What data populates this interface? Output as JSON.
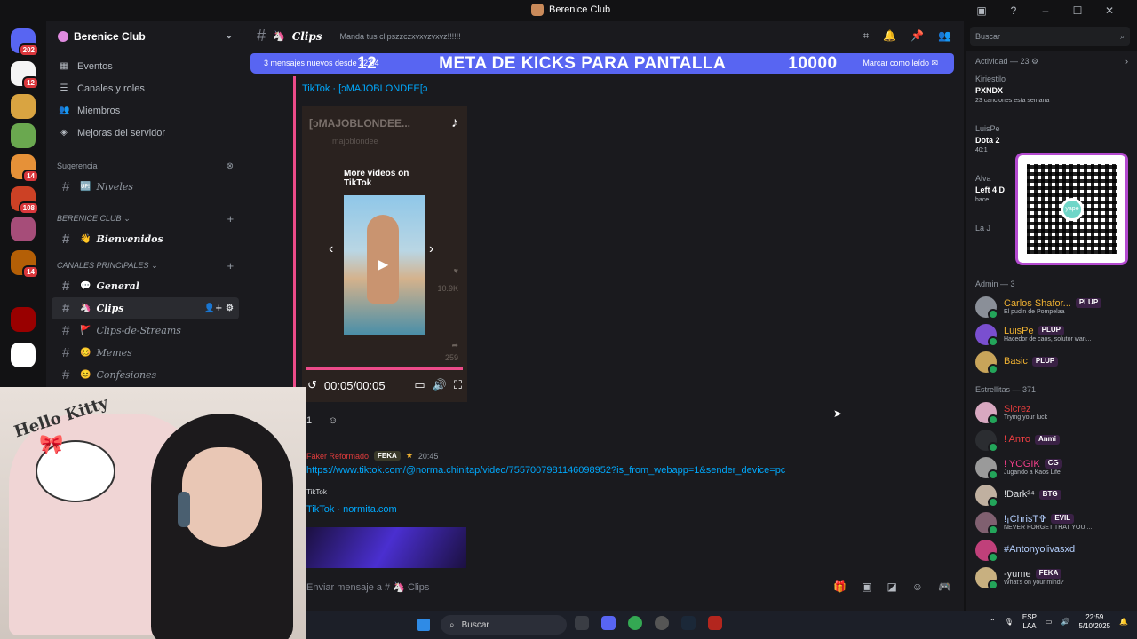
{
  "window": {
    "title": "Berenice Club"
  },
  "servers": [
    {
      "color": "#5865f2",
      "badge": "202",
      "icon": "discord-icon"
    },
    {
      "color": "#f5f5f5",
      "badge": "12",
      "icon": "server-icon"
    },
    {
      "color": "#d9a441",
      "badge": "",
      "icon": "server-icon"
    },
    {
      "color": "#6aa84f",
      "badge": "",
      "icon": "server-icon"
    },
    {
      "color": "#e69138",
      "badge": "14",
      "icon": "server-icon"
    },
    {
      "color": "#cc4125",
      "badge": "108",
      "icon": "server-icon"
    },
    {
      "color": "#a64d79",
      "badge": "",
      "icon": "server-icon"
    },
    {
      "color": "#b45f06",
      "badge": "14",
      "icon": "server-icon"
    },
    {
      "color": "#990000",
      "badge": "",
      "icon": "server-icon"
    },
    {
      "color": "#ffffff",
      "badge": "",
      "icon": "server-icon"
    }
  ],
  "guild": {
    "name": "Berenice Club",
    "nav": [
      {
        "label": "Eventos",
        "icon": "calendar-icon"
      },
      {
        "label": "Canales y roles",
        "icon": "list-icon"
      },
      {
        "label": "Miembros",
        "icon": "members-icon"
      },
      {
        "label": "Mejoras del servidor",
        "icon": "boost-icon"
      }
    ],
    "suggestion_label": "Sugerencia",
    "suggestion_channel": "Niveles",
    "cat1": "BERENICE CLUB",
    "welcome_channel": "Bienvenidos",
    "cat2": "CANALES PRINCIPALES",
    "channels": [
      {
        "name": "General",
        "emoji": "💬",
        "state": "bold"
      },
      {
        "name": "Clips",
        "emoji": "🦄",
        "state": "active"
      },
      {
        "name": "Clips-de-Streams",
        "emoji": "🚩",
        "state": ""
      },
      {
        "name": "Memes",
        "emoji": "🥴",
        "state": ""
      },
      {
        "name": "Confesiones",
        "emoji": "😊",
        "state": ""
      }
    ]
  },
  "channel": {
    "name": "Clips",
    "topic": "Manda tus clipszzczxvxvzvxvz!!!!!!",
    "new_messages": "3 mensajes nuevos desde 22:54",
    "mark_read": "Marcar como leído",
    "overlay_left": "12",
    "overlay_title": "META DE KICKS PARA PANTALLA",
    "overlay_right": "10000"
  },
  "messages": {
    "embed_provider": "TikTok · [ↄMAJOBLONDEE[ↄ",
    "video_head": "[ↄMAJOBLONDEE...",
    "video_sub": "majoblondee",
    "more_videos": "More videos on TikTok",
    "video_time": "00:05/00:05",
    "side_likes": "10.9K",
    "side_shares": "259",
    "reaction_count": "1",
    "author2": "Faker Reformado",
    "author2_tag": "FEKA",
    "author2_time": "20:45",
    "link": "https://www.tiktok.com/@norma.chinitap/video/7557007981146098952?is_from_webapp=1&sender_device=pc",
    "embed2_site": "TikTok",
    "embed2_title": "TikTok · normita.com"
  },
  "composer": {
    "placeholder": "Enviar mensaje a # 🦄 Clips"
  },
  "search": {
    "placeholder": "Buscar"
  },
  "activity": {
    "header": "Actividad — 23",
    "items": [
      {
        "who": "Kiriestilo",
        "game": "PXNDX",
        "detail": "23 canciones esta semana"
      },
      {
        "who": "LuisPe",
        "game": "Dota 2",
        "detail": "40:1"
      },
      {
        "who": "Alva",
        "game": "Left 4 D",
        "detail": "hace"
      },
      {
        "who": "La J",
        "game": "",
        "detail": ""
      }
    ]
  },
  "members": {
    "admin_header": "Admin — 3",
    "admins": [
      {
        "name": "Carlos Shafor...",
        "badge": "PLUP",
        "status": "El pudin de Pompelaa",
        "color": "#f0b232",
        "avatar": "#8a8f98"
      },
      {
        "name": "LuisPe",
        "badge": "PLUP",
        "status": "Hacedor de caos, solutor wan...",
        "color": "#f0b232",
        "avatar": "#7a4fd0"
      },
      {
        "name": "Basic",
        "badge": "PLUP",
        "status": "",
        "color": "#f0b232",
        "avatar": "#c8a45a"
      }
    ],
    "stars_header": "Estrellitas — 371",
    "stars": [
      {
        "name": "Sicrez",
        "badge": "",
        "status": "Trying your luck",
        "color": "#e03c3c",
        "avatar": "#d8a8c0"
      },
      {
        "name": "! Anто",
        "badge": "Anmi",
        "status": "",
        "color": "#f23f43",
        "avatar": "#2b2d31"
      },
      {
        "name": "! YOGIK",
        "badge": "CG",
        "status": "Jugando a Kaos Life",
        "color": "#f23f8a",
        "avatar": "#9a9a9a"
      },
      {
        "name": "!Dark²⁴",
        "badge": "BTG",
        "status": "",
        "color": "#dbdee1",
        "avatar": "#c0b0a0"
      },
      {
        "name": "!¡ChrisT✞",
        "badge": "EVIL",
        "status": "NEVER FORGET THAT YOU ...",
        "color": "#b5d0ff",
        "avatar": "#806070"
      },
      {
        "name": "#Antonyolivasxd",
        "badge": "",
        "status": "",
        "color": "#b5d0ff",
        "avatar": "#c0407a"
      },
      {
        "name": "-yume",
        "badge": "FEKA",
        "status": "What's on your mind?",
        "color": "#dbdee1",
        "avatar": "#c8b080"
      }
    ]
  },
  "webcam": {
    "caption": "Hello Kitty"
  },
  "taskbar": {
    "search": "Buscar",
    "lang1": "ESP",
    "lang2": "LAA",
    "time": "22:59",
    "date": "5/10/2025"
  }
}
